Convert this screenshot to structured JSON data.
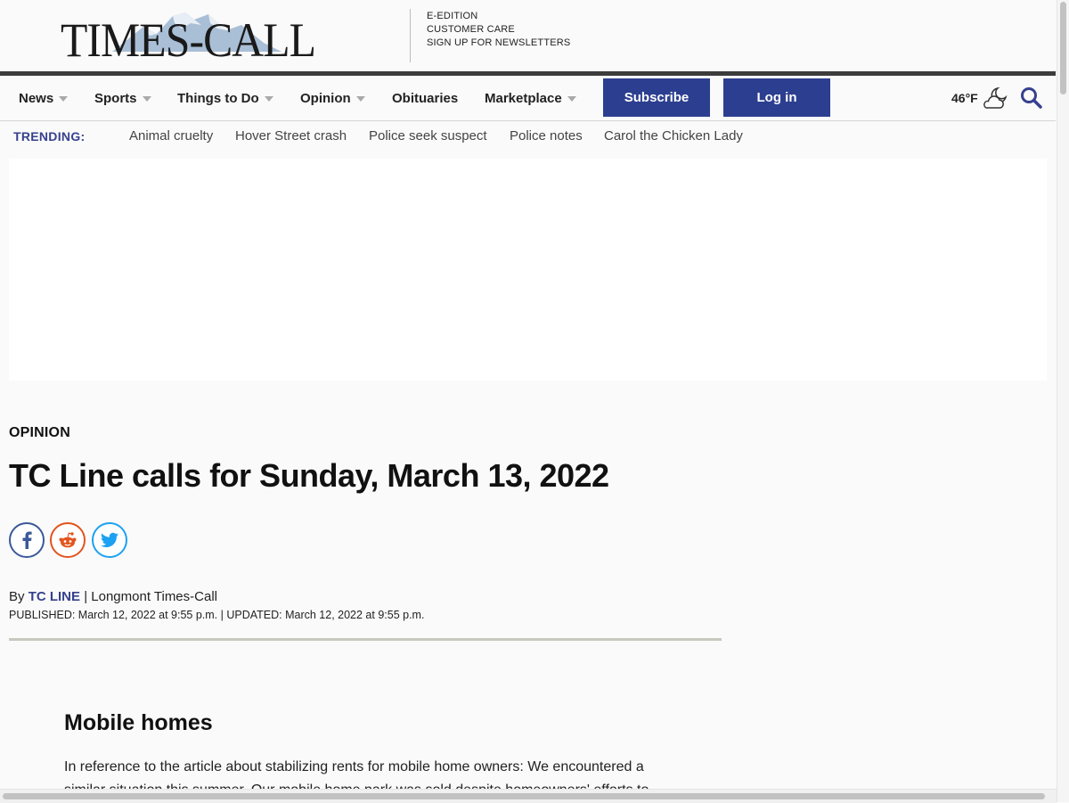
{
  "masthead": {
    "logo_text": "TIMES-CALL",
    "links": [
      "E-EDITION",
      "CUSTOMER CARE",
      "SIGN UP FOR NEWSLETTERS"
    ]
  },
  "nav": {
    "items": [
      {
        "label": "News",
        "has_dropdown": true
      },
      {
        "label": "Sports",
        "has_dropdown": true
      },
      {
        "label": "Things to Do",
        "has_dropdown": true
      },
      {
        "label": "Opinion",
        "has_dropdown": true
      },
      {
        "label": "Obituaries",
        "has_dropdown": false
      },
      {
        "label": "Marketplace",
        "has_dropdown": true
      }
    ],
    "subscribe_label": "Subscribe",
    "login_label": "Log in",
    "weather_temp": "46°F",
    "weather_icon": "partly-cloudy-night-icon"
  },
  "trending": {
    "label": "TRENDING:",
    "links": [
      "Animal cruelty",
      "Hover Street crash",
      "Police seek suspect",
      "Police notes",
      "Carol the Chicken Lady"
    ]
  },
  "article": {
    "section": "OPINION",
    "headline": "TC Line calls for Sunday, March 13, 2022",
    "share_icons": [
      "facebook-icon",
      "reddit-icon",
      "twitter-icon"
    ],
    "byline_prefix": "By ",
    "author": "TC LINE",
    "byline_separator": " | ",
    "publication": "Longmont Times-Call",
    "dateline": "PUBLISHED: March 12, 2022 at 9:55 p.m. | UPDATED: March 12, 2022 at 9:55 p.m.",
    "subhead": "Mobile homes",
    "body": "In reference to the article about stabilizing rents for mobile home owners: We encountered a similar situation this summer. Our mobile home park was sold despite homeowners' efforts to"
  },
  "colors": {
    "brand_blue": "#2c3e8f",
    "trending_blue": "#36418f",
    "facebook": "#3b5998",
    "reddit": "#e3541d",
    "twitter": "#1da1f2"
  }
}
